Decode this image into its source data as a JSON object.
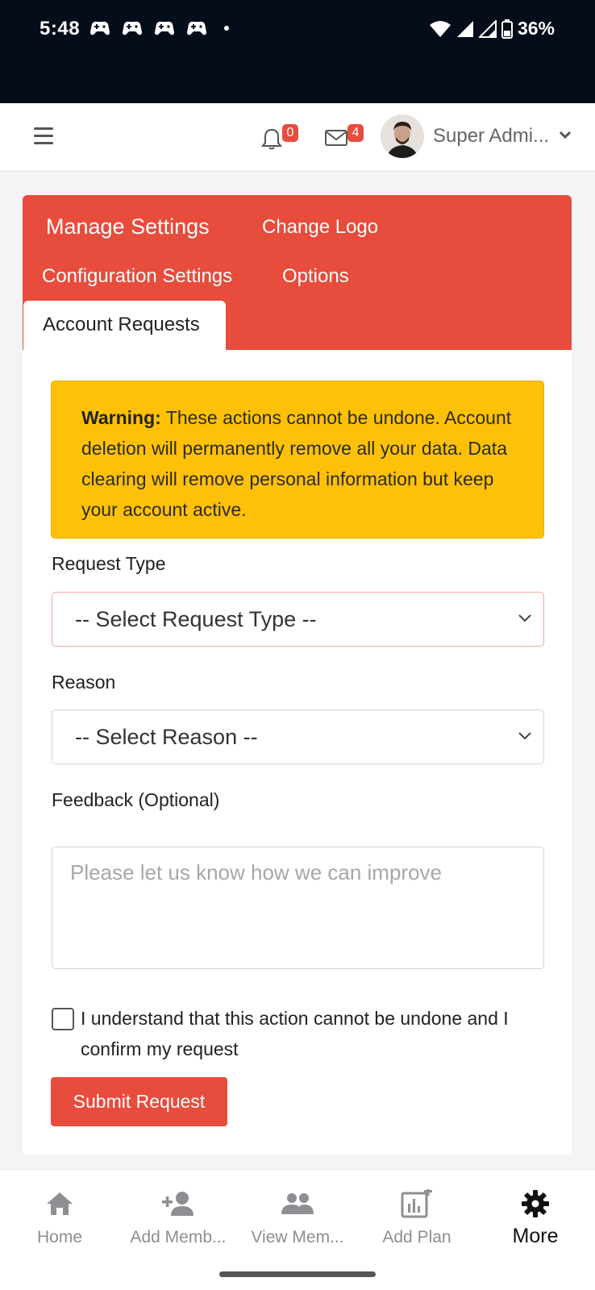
{
  "status_bar": {
    "time": "5:48",
    "battery": "36%",
    "app_icons": [
      "game-controller-icon",
      "game-controller-icon",
      "game-controller-icon",
      "game-controller-icon"
    ]
  },
  "header": {
    "notifications_count": "0",
    "messages_count": "4",
    "user_name": "Super Admi..."
  },
  "tabs": {
    "manage_settings": "Manage Settings",
    "change_logo": "Change Logo",
    "configuration_settings": "Configuration Settings",
    "options": "Options",
    "account_requests": "Account Requests",
    "active": "Account Requests"
  },
  "warning": {
    "title": "Warning:",
    "message": "These actions cannot be undone. Account deletion will permanently remove all your data. Data clearing will remove personal information but keep your account active."
  },
  "form": {
    "request_type_label": "Request Type",
    "request_type_value": "-- Select Request Type --",
    "reason_label": "Reason",
    "reason_value": "-- Select Reason --",
    "feedback_label": "Feedback (Optional)",
    "feedback_placeholder": "Please let us know how we can improve",
    "confirm_text": "I understand that this action cannot be undone and I confirm my request",
    "confirm_checked": false,
    "submit_label": "Submit Request"
  },
  "bottom_nav": [
    {
      "label": "Home",
      "icon": "home-icon"
    },
    {
      "label": "Add Memb...",
      "icon": "add-member-icon"
    },
    {
      "label": "View Mem...",
      "icon": "members-icon"
    },
    {
      "label": "Add Plan",
      "icon": "add-plan-icon"
    },
    {
      "label": "More",
      "icon": "gear-icon",
      "active": true
    }
  ],
  "colors": {
    "brand_red": "#e74c3c",
    "warning_yellow": "#ffc107",
    "status_bar": "#050c1a"
  }
}
